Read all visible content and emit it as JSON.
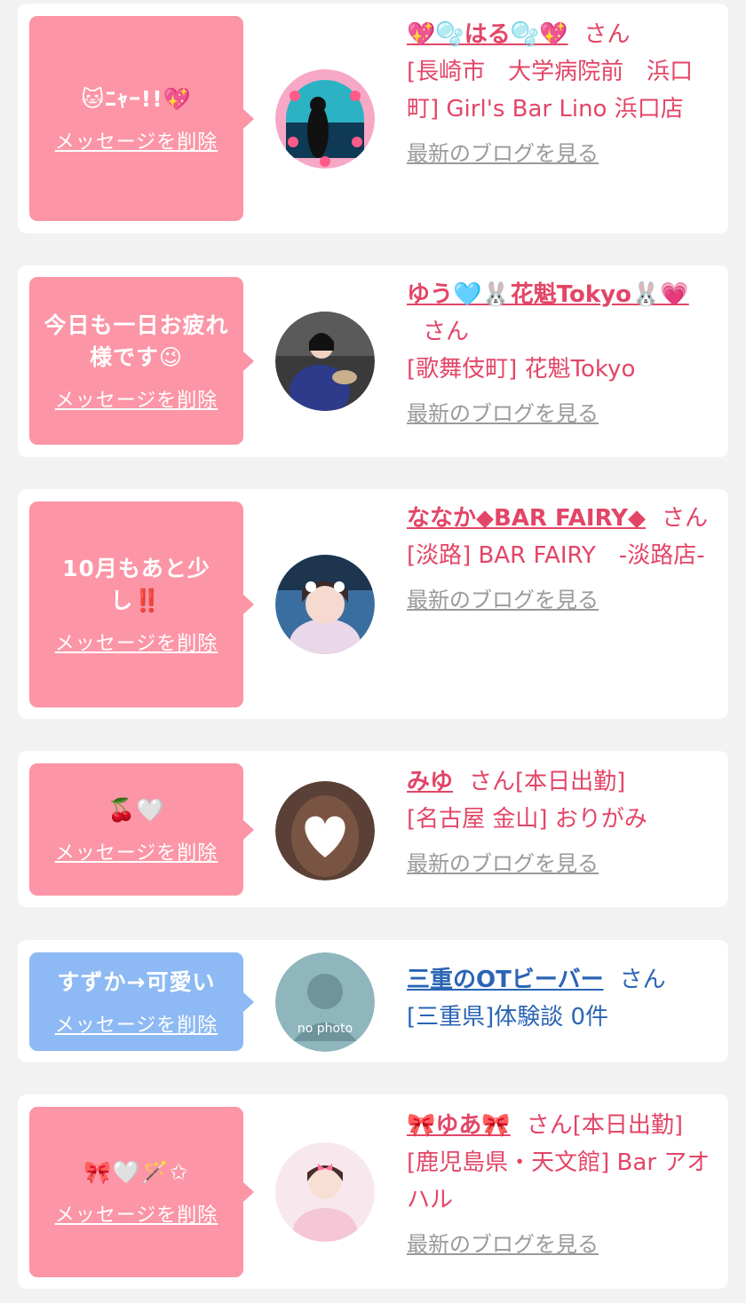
{
  "messages": [
    {
      "bubble_text": "🐱ﾆｬｰ!!💖",
      "delete_label": "メッセージを削除",
      "name": "💖🫧はる🫧💖",
      "honorific": "さん",
      "status": "",
      "shop": "[長崎市　大学病院前　浜口町] Girl's Bar Lino 浜口店",
      "blog_label": "最新のブログを見る",
      "theme": "pink"
    },
    {
      "bubble_text": "今日も一日お疲れ様です😉",
      "delete_label": "メッセージを削除",
      "name": "ゆう🩵🐰花魁Tokyo🐰💗",
      "honorific": "さん",
      "status": "",
      "shop": "[歌舞伎町] 花魁Tokyo",
      "blog_label": "最新のブログを見る",
      "theme": "pink"
    },
    {
      "bubble_text": "10月もあと少し‼️",
      "delete_label": "メッセージを削除",
      "name": "ななか◆BAR FAIRY◆",
      "honorific": "さん",
      "status": "",
      "shop": "[淡路] BAR FAIRY　-淡路店-",
      "blog_label": "最新のブログを見る",
      "theme": "pink"
    },
    {
      "bubble_text": "🍒🤍",
      "delete_label": "メッセージを削除",
      "name": "みゆ",
      "honorific": "さん",
      "status": "[本日出勤]",
      "shop": "[名古屋 金山] おりがみ",
      "blog_label": "最新のブログを見る",
      "theme": "pink"
    },
    {
      "bubble_text": "すずか→可愛い",
      "delete_label": "メッセージを削除",
      "name": "三重のOTビーバー",
      "honorific": "さん",
      "status": "",
      "shop": "[三重県]体験談 0件",
      "blog_label": "",
      "avatar_text": "no photo",
      "theme": "blue"
    },
    {
      "bubble_text": "🎀🤍🪄✩",
      "delete_label": "メッセージを削除",
      "name": "🎀ゆあ🎀",
      "honorific": "さん",
      "status": "[本日出勤]",
      "shop": "[鹿児島県・天文館] Bar アオハル",
      "blog_label": "最新のブログを見る",
      "theme": "pink"
    }
  ]
}
